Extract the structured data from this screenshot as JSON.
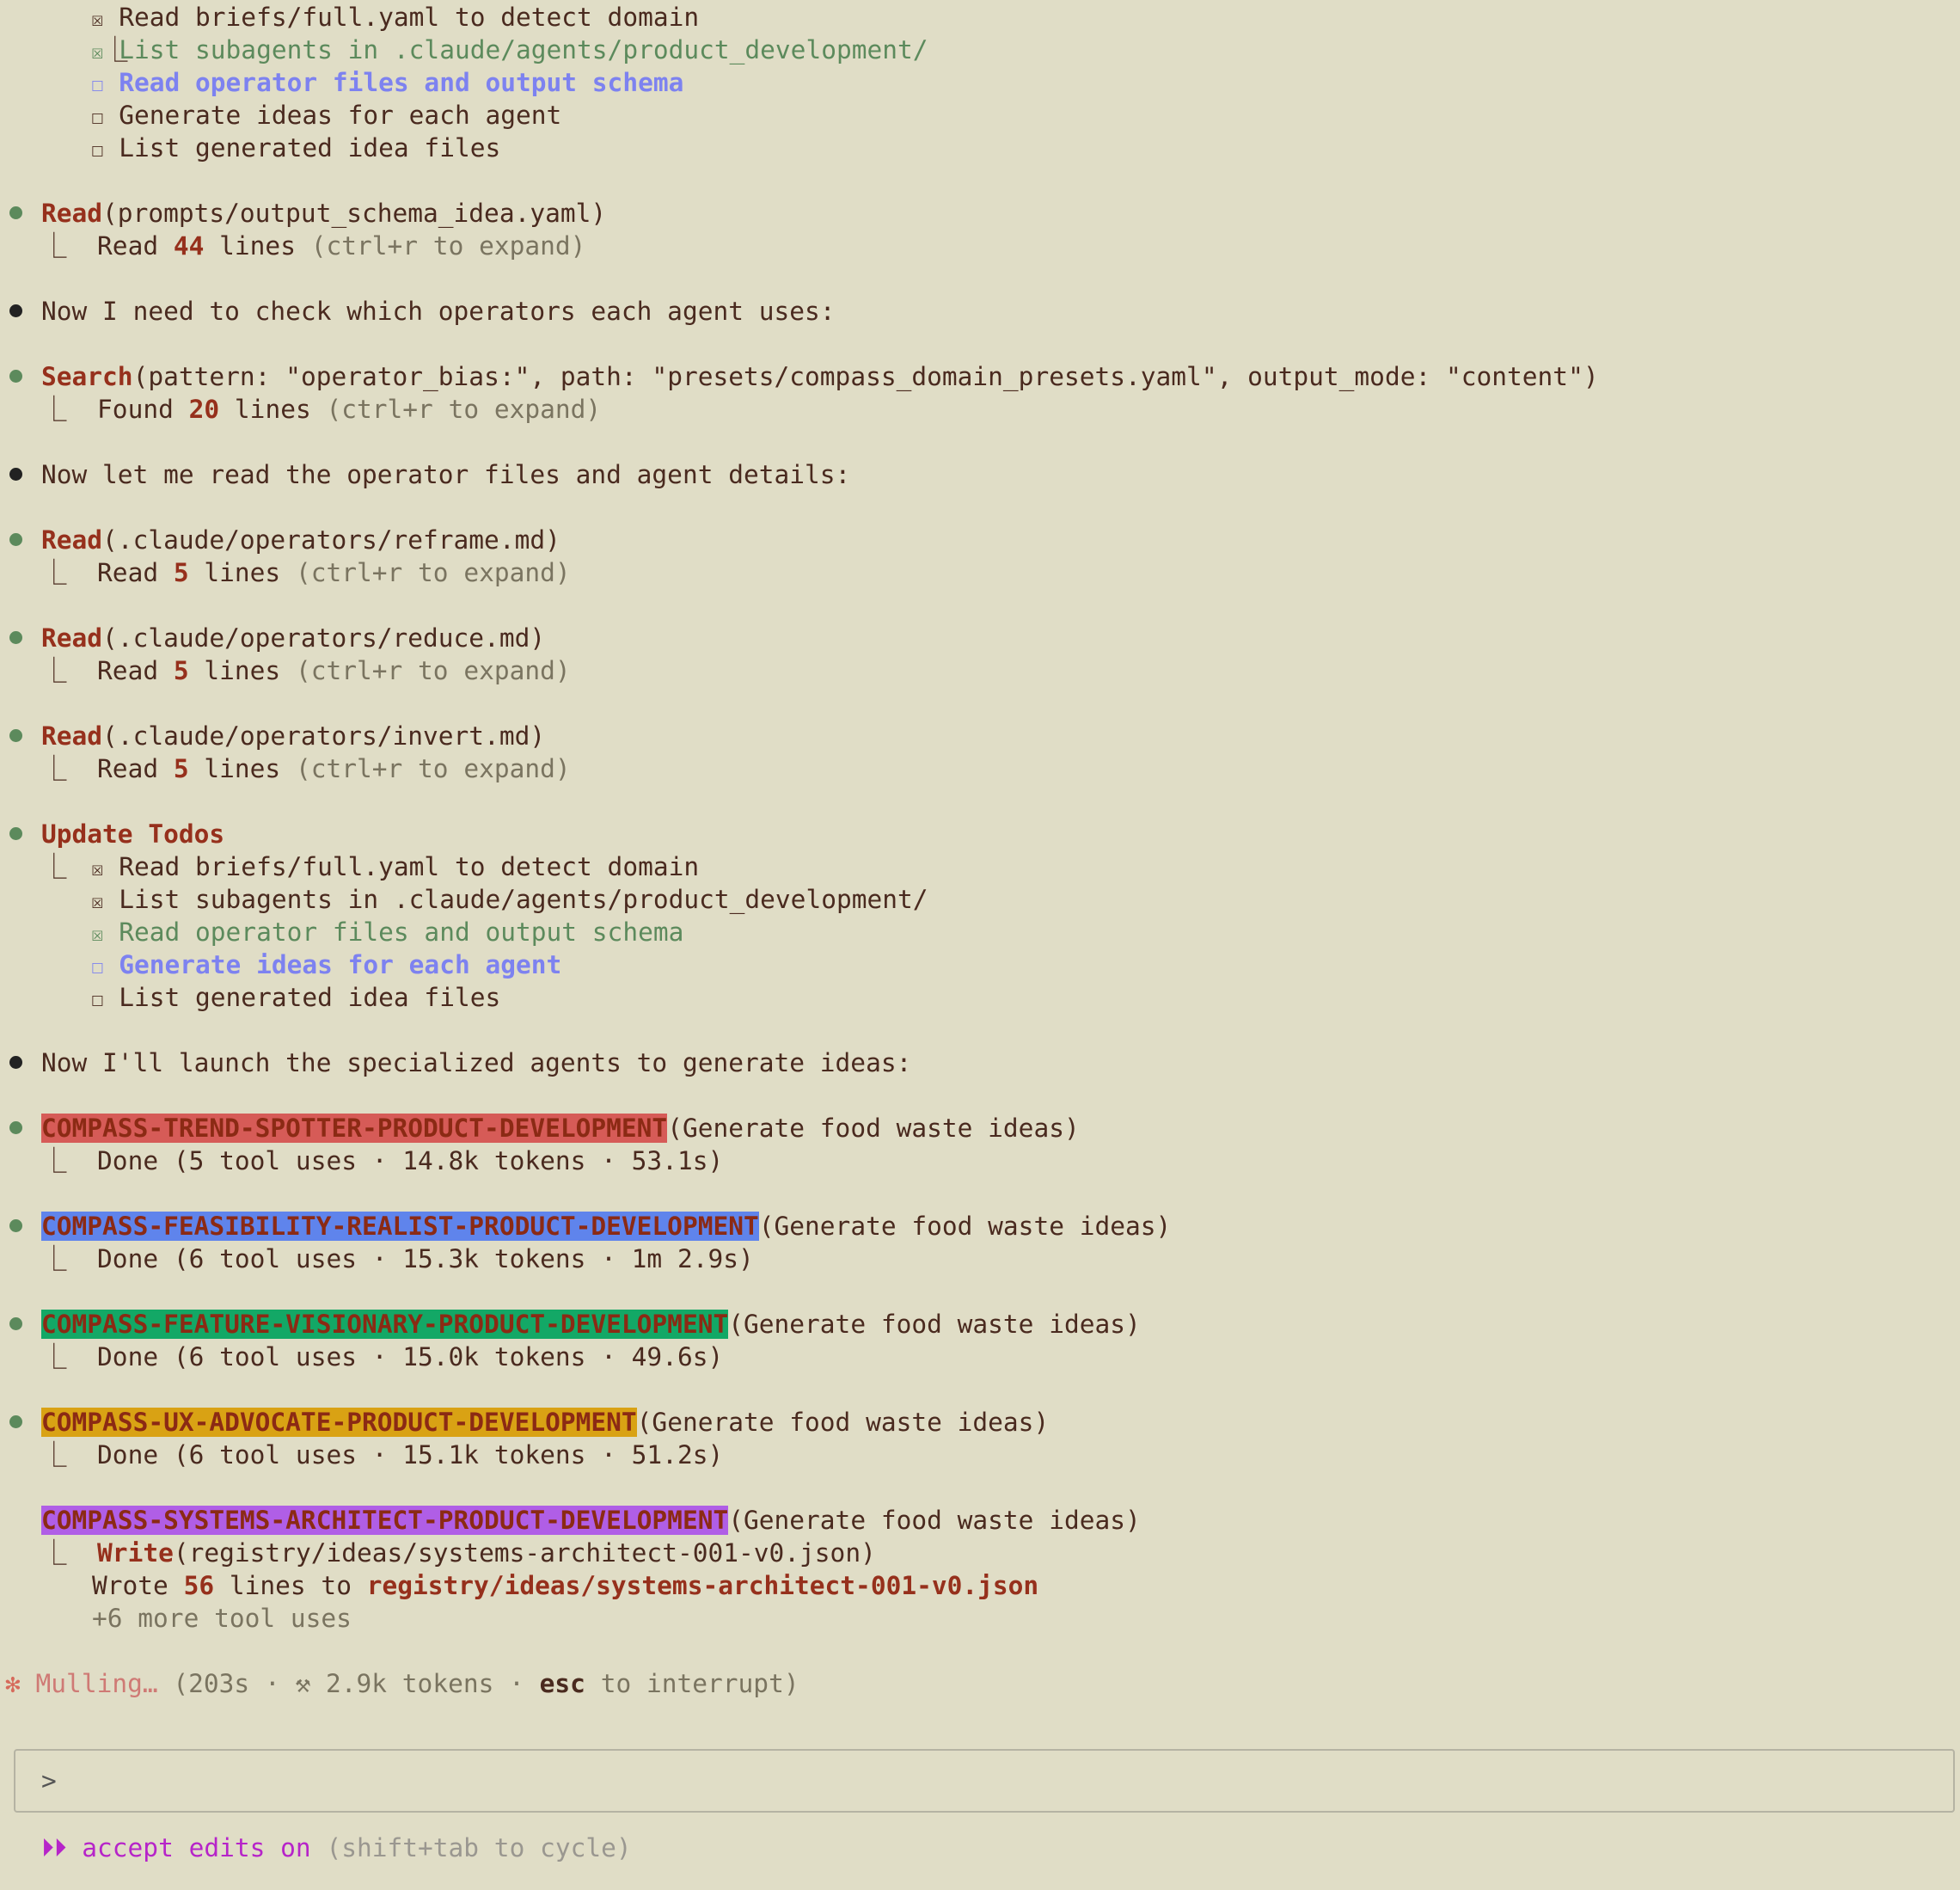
{
  "todos_first": [
    {
      "box": "☒",
      "text": "Read briefs/full.yaml to detect domain",
      "state": "checked"
    },
    {
      "box": "☒",
      "text": "List subagents in .claude/agents/product_development/",
      "state": "done"
    },
    {
      "box": "☐",
      "text": "Read operator files and output schema",
      "state": "active"
    },
    {
      "box": "☐",
      "text": "Generate ideas for each agent",
      "state": "pending"
    },
    {
      "box": "☐",
      "text": "List generated idea files",
      "state": "pending"
    }
  ],
  "read_schema": {
    "tool": "Read",
    "args": "(prompts/output_schema_idea.yaml)",
    "result_pre": "Read ",
    "count": "44",
    "result_post": " lines ",
    "hint": "(ctrl+r to expand)"
  },
  "msg_check_ops": "Now I need to check which operators each agent uses:",
  "search": {
    "tool": "Search",
    "args": "(pattern: \"operator_bias:\", path: \"presets/compass_domain_presets.yaml\", output_mode: \"content\")",
    "result_pre": "Found ",
    "count": "20",
    "result_post": " lines ",
    "hint": "(ctrl+r to expand)"
  },
  "msg_read_ops": "Now let me read the operator files and agent details:",
  "reads": [
    {
      "tool": "Read",
      "args": "(.claude/operators/reframe.md)",
      "result_pre": "Read ",
      "count": "5",
      "result_post": " lines ",
      "hint": "(ctrl+r to expand)"
    },
    {
      "tool": "Read",
      "args": "(.claude/operators/reduce.md)",
      "result_pre": "Read ",
      "count": "5",
      "result_post": " lines ",
      "hint": "(ctrl+r to expand)"
    },
    {
      "tool": "Read",
      "args": "(.claude/operators/invert.md)",
      "result_pre": "Read ",
      "count": "5",
      "result_post": " lines ",
      "hint": "(ctrl+r to expand)"
    }
  ],
  "update_todos_title": "Update Todos",
  "todos_second": [
    {
      "box": "☒",
      "text": "Read briefs/full.yaml to detect domain",
      "state": "checked"
    },
    {
      "box": "☒",
      "text": "List subagents in .claude/agents/product_development/",
      "state": "checked"
    },
    {
      "box": "☒",
      "text": "Read operator files and output schema",
      "state": "done"
    },
    {
      "box": "☐",
      "text": "Generate ideas for each agent",
      "state": "active"
    },
    {
      "box": "☐",
      "text": "List generated idea files",
      "state": "pending"
    }
  ],
  "msg_launch": "Now I'll launch the specialized agents to generate ideas:",
  "agents": [
    {
      "name": "COMPASS-TREND-SPOTTER-PRODUCT-DEVELOPMENT",
      "args": "(Generate food waste ideas)",
      "result": "Done (5 tool uses · 14.8k tokens · 53.1s)",
      "color": "#d65b57"
    },
    {
      "name": "COMPASS-FEASIBILITY-REALIST-PRODUCT-DEVELOPMENT",
      "args": "(Generate food waste ideas)",
      "result": "Done (6 tool uses · 15.3k tokens · 1m 2.9s)",
      "color": "#5f84ec"
    },
    {
      "name": "COMPASS-FEATURE-VISIONARY-PRODUCT-DEVELOPMENT",
      "args": "(Generate food waste ideas)",
      "result": "Done (6 tool uses · 15.0k tokens · 49.6s)",
      "color": "#13a866"
    },
    {
      "name": "COMPASS-UX-ADVOCATE-PRODUCT-DEVELOPMENT",
      "args": "(Generate food waste ideas)",
      "result": "Done (6 tool uses · 15.1k tokens · 51.2s)",
      "color": "#d9a214"
    }
  ],
  "running_agent": {
    "name": "COMPASS-SYSTEMS-ARCHITECT-PRODUCT-DEVELOPMENT",
    "args": "(Generate food waste ideas)",
    "color": "#b05ee6",
    "write_tool": "Write",
    "write_args": "(registry/ideas/systems-architect-001-v0.json)",
    "wrote_pre": "Wrote ",
    "wrote_count": "56",
    "wrote_mid": " lines to ",
    "wrote_path": "registry/ideas/systems-architect-001-v0.json",
    "more": "+6 more tool uses"
  },
  "status": {
    "spinner": "✻",
    "verb": "Mulling…",
    "pre": " (203s · ⚒ 2.9k tokens · ",
    "key": "esc",
    "post": " to interrupt)"
  },
  "prompt_symbol": ">",
  "mode": {
    "arrows": "⏵⏵",
    "label": " accept edits on ",
    "hint": "(shift+tab to cycle)"
  },
  "tree_corner": "⎿"
}
